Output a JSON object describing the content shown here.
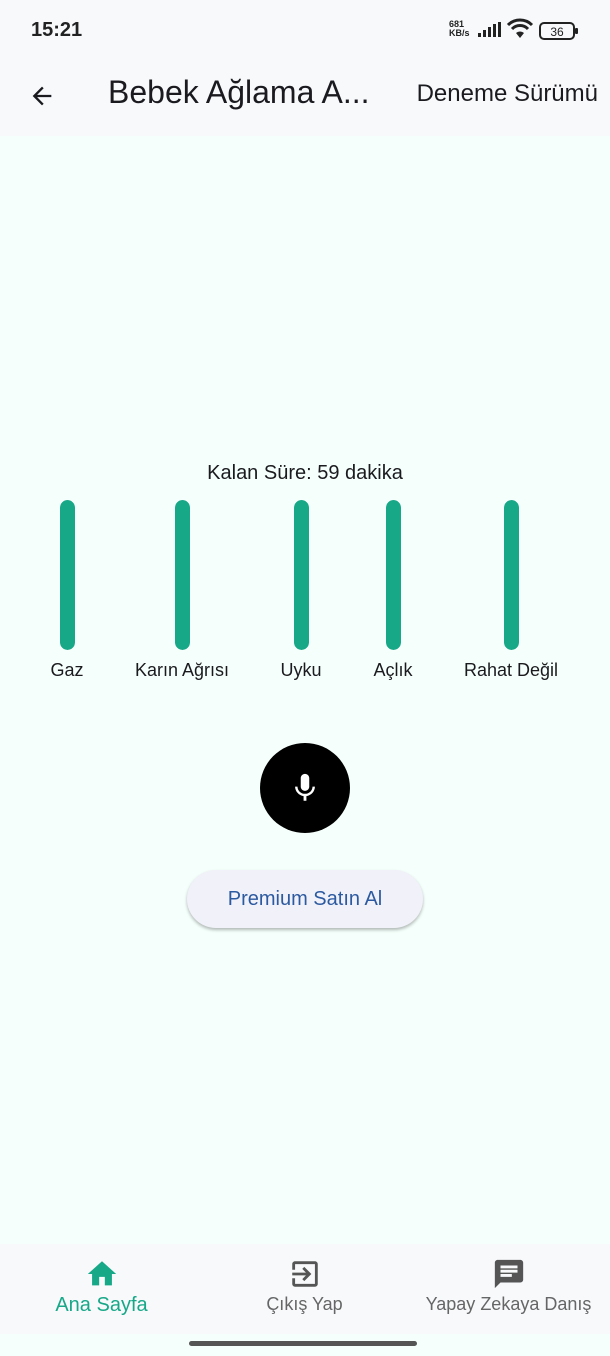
{
  "status_bar": {
    "time": "15:21",
    "net_speed_value": "681",
    "net_speed_unit": "KB/s",
    "battery": "36"
  },
  "app_bar": {
    "title": "Bebek Ağlama A...",
    "action": "Deneme Sürümü"
  },
  "main": {
    "remaining_time": "Kalan Süre: 59 dakika",
    "categories": [
      {
        "label": "Gaz",
        "level": 1.0
      },
      {
        "label": "Karın Ağrısı",
        "level": 1.0
      },
      {
        "label": "Uyku",
        "level": 1.0
      },
      {
        "label": "Açlık",
        "level": 1.0
      },
      {
        "label": "Rahat Değil",
        "level": 1.0
      }
    ],
    "premium_button": "Premium Satın Al"
  },
  "bottom_nav": {
    "items": [
      {
        "label": "Ana Sayfa",
        "icon": "home-icon",
        "active": true
      },
      {
        "label": "Çıkış Yap",
        "icon": "exit-icon",
        "active": false
      },
      {
        "label": "Yapay Zekaya Danış",
        "icon": "chat-icon",
        "active": false
      }
    ]
  },
  "colors": {
    "accent": "#17a888",
    "background": "#f5fffb",
    "bar_background": "#f7f9fb",
    "premium_text": "#2c5aa0"
  }
}
